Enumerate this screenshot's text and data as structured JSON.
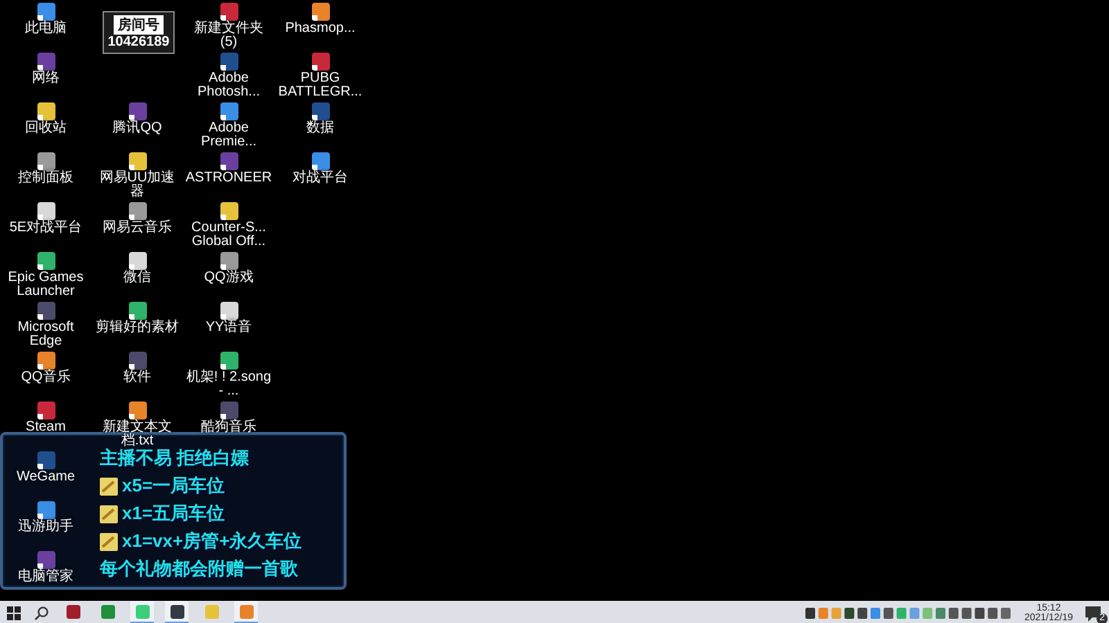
{
  "logo": {
    "caption": "房间号",
    "number": "10426189"
  },
  "desktop_columns": [
    [
      {
        "label": "此电脑"
      },
      {
        "label": "网络"
      },
      {
        "label": "回收站"
      },
      {
        "label": "控制面板"
      },
      {
        "label": "5E对战平台"
      },
      {
        "label": "Epic Games Launcher"
      },
      {
        "label": "Microsoft Edge"
      },
      {
        "label": "QQ音乐"
      },
      {
        "label": "Steam"
      },
      {
        "label": "WeGame"
      },
      {
        "label": "迅游助手"
      },
      {
        "label": "电脑管家"
      }
    ],
    [
      {},
      {},
      {
        "label": "腾讯QQ"
      },
      {
        "label": "网易UU加速器"
      },
      {
        "label": "网易云音乐"
      },
      {
        "label": "微信"
      },
      {
        "label": "剪辑好的素材"
      },
      {
        "label": "软件"
      },
      {
        "label": "新建文本文档.txt"
      }
    ],
    [
      {
        "label": "新建文件夹 (5)"
      },
      {
        "label": "Adobe Photosh..."
      },
      {
        "label": "Adobe Premie..."
      },
      {
        "label": "ASTRONEER"
      },
      {
        "label": "Counter-S... Global Off..."
      },
      {
        "label": "QQ游戏"
      },
      {
        "label": "YY语音"
      },
      {
        "label": "机架! ! 2.song - ..."
      },
      {
        "label": "酷狗音乐"
      }
    ],
    [
      {
        "label": "Phasmop..."
      },
      {
        "label": "PUBG BATTLEGR..."
      },
      {
        "label": "数据"
      },
      {
        "label": "对战平台"
      }
    ]
  ],
  "overlay": {
    "lines": [
      {
        "kind": "text",
        "text": "主播不易 拒绝白嫖"
      },
      {
        "kind": "gift",
        "text": "x5=一局车位"
      },
      {
        "kind": "gift",
        "text": "x1=五局车位"
      },
      {
        "kind": "gift",
        "text": "x1=vx+房管+永久车位"
      },
      {
        "kind": "text",
        "text": "每个礼物都会附赠一首歌"
      }
    ]
  },
  "taskbar": {
    "apps": [
      {
        "running": false
      },
      {
        "running": false
      },
      {
        "running": true
      },
      {
        "running": true
      },
      {
        "running": false
      },
      {
        "running": true
      }
    ],
    "clock": {
      "time": "15:12",
      "date": "2021/12/19"
    },
    "notifications": {
      "count": "2"
    }
  }
}
